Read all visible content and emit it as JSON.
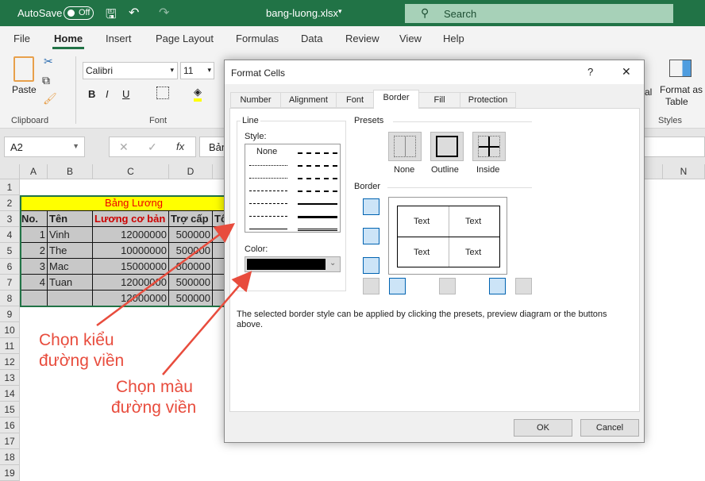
{
  "titlebar": {
    "autosave": "AutoSave",
    "toggle": "Off",
    "filename": "bang-luong.xlsx",
    "search": "Search"
  },
  "menu": [
    "File",
    "Home",
    "Insert",
    "Page Layout",
    "Formulas",
    "Data",
    "Review",
    "View",
    "Help"
  ],
  "ribbon": {
    "paste": "Paste",
    "clipboard": "Clipboard",
    "font_name": "Calibri",
    "font_size": "11",
    "font": "Font",
    "bold": "B",
    "italic": "I",
    "underline": "U",
    "format_as": "Format as",
    "table": "Table",
    "styles": "Styles",
    "partial": "al"
  },
  "formula": {
    "namebox": "A2",
    "fx": "fx",
    "content": "Bản"
  },
  "columns": [
    "A",
    "B",
    "C",
    "D",
    "N"
  ],
  "rows": [
    "1",
    "2",
    "3",
    "4",
    "5",
    "6",
    "7",
    "8",
    "9",
    "10",
    "11",
    "12",
    "13",
    "14",
    "15",
    "16",
    "17",
    "18",
    "19"
  ],
  "sheet": {
    "title": "Bảng Lương",
    "headers": [
      "No.",
      "Tên",
      "Lương cơ bản",
      "Trợ cấp",
      "Tổ"
    ],
    "data": [
      [
        "1",
        "Vinh",
        "12000000",
        "500000"
      ],
      [
        "2",
        "The",
        "10000000",
        "500000"
      ],
      [
        "3",
        "Mac",
        "15000000",
        "800000"
      ],
      [
        "4",
        "Tuan",
        "12000000",
        "500000"
      ],
      [
        "",
        "",
        "12000000",
        "500000"
      ]
    ]
  },
  "dialog": {
    "title": "Format Cells",
    "help": "?",
    "close": "✕",
    "tabs": [
      "Number",
      "Alignment",
      "Font",
      "Border",
      "Fill",
      "Protection"
    ],
    "line": "Line",
    "style": "Style:",
    "none_style": "None",
    "color": "Color:",
    "color_value": "#000000",
    "presets": "Presets",
    "preset_labels": [
      "None",
      "Outline",
      "Inside"
    ],
    "border": "Border",
    "preview_text": "Text",
    "hint": "The selected border style can be applied by clicking the presets, preview diagram or the buttons above.",
    "ok": "OK",
    "cancel": "Cancel"
  },
  "annotations": {
    "style": [
      "Chọn kiểu",
      "đường viền"
    ],
    "color": [
      "Chọn màu",
      "đường viền"
    ],
    "color_hex": "#e84c3d"
  }
}
